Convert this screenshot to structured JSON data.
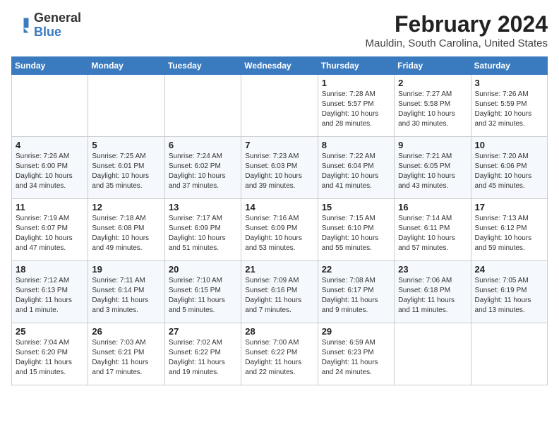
{
  "header": {
    "logo_general": "General",
    "logo_blue": "Blue",
    "month_year": "February 2024",
    "location": "Mauldin, South Carolina, United States"
  },
  "weekdays": [
    "Sunday",
    "Monday",
    "Tuesday",
    "Wednesday",
    "Thursday",
    "Friday",
    "Saturday"
  ],
  "weeks": [
    [
      {
        "day": "",
        "content": ""
      },
      {
        "day": "",
        "content": ""
      },
      {
        "day": "",
        "content": ""
      },
      {
        "day": "",
        "content": ""
      },
      {
        "day": "1",
        "content": "Sunrise: 7:28 AM\nSunset: 5:57 PM\nDaylight: 10 hours\nand 28 minutes."
      },
      {
        "day": "2",
        "content": "Sunrise: 7:27 AM\nSunset: 5:58 PM\nDaylight: 10 hours\nand 30 minutes."
      },
      {
        "day": "3",
        "content": "Sunrise: 7:26 AM\nSunset: 5:59 PM\nDaylight: 10 hours\nand 32 minutes."
      }
    ],
    [
      {
        "day": "4",
        "content": "Sunrise: 7:26 AM\nSunset: 6:00 PM\nDaylight: 10 hours\nand 34 minutes."
      },
      {
        "day": "5",
        "content": "Sunrise: 7:25 AM\nSunset: 6:01 PM\nDaylight: 10 hours\nand 35 minutes."
      },
      {
        "day": "6",
        "content": "Sunrise: 7:24 AM\nSunset: 6:02 PM\nDaylight: 10 hours\nand 37 minutes."
      },
      {
        "day": "7",
        "content": "Sunrise: 7:23 AM\nSunset: 6:03 PM\nDaylight: 10 hours\nand 39 minutes."
      },
      {
        "day": "8",
        "content": "Sunrise: 7:22 AM\nSunset: 6:04 PM\nDaylight: 10 hours\nand 41 minutes."
      },
      {
        "day": "9",
        "content": "Sunrise: 7:21 AM\nSunset: 6:05 PM\nDaylight: 10 hours\nand 43 minutes."
      },
      {
        "day": "10",
        "content": "Sunrise: 7:20 AM\nSunset: 6:06 PM\nDaylight: 10 hours\nand 45 minutes."
      }
    ],
    [
      {
        "day": "11",
        "content": "Sunrise: 7:19 AM\nSunset: 6:07 PM\nDaylight: 10 hours\nand 47 minutes."
      },
      {
        "day": "12",
        "content": "Sunrise: 7:18 AM\nSunset: 6:08 PM\nDaylight: 10 hours\nand 49 minutes."
      },
      {
        "day": "13",
        "content": "Sunrise: 7:17 AM\nSunset: 6:09 PM\nDaylight: 10 hours\nand 51 minutes."
      },
      {
        "day": "14",
        "content": "Sunrise: 7:16 AM\nSunset: 6:09 PM\nDaylight: 10 hours\nand 53 minutes."
      },
      {
        "day": "15",
        "content": "Sunrise: 7:15 AM\nSunset: 6:10 PM\nDaylight: 10 hours\nand 55 minutes."
      },
      {
        "day": "16",
        "content": "Sunrise: 7:14 AM\nSunset: 6:11 PM\nDaylight: 10 hours\nand 57 minutes."
      },
      {
        "day": "17",
        "content": "Sunrise: 7:13 AM\nSunset: 6:12 PM\nDaylight: 10 hours\nand 59 minutes."
      }
    ],
    [
      {
        "day": "18",
        "content": "Sunrise: 7:12 AM\nSunset: 6:13 PM\nDaylight: 11 hours\nand 1 minute."
      },
      {
        "day": "19",
        "content": "Sunrise: 7:11 AM\nSunset: 6:14 PM\nDaylight: 11 hours\nand 3 minutes."
      },
      {
        "day": "20",
        "content": "Sunrise: 7:10 AM\nSunset: 6:15 PM\nDaylight: 11 hours\nand 5 minutes."
      },
      {
        "day": "21",
        "content": "Sunrise: 7:09 AM\nSunset: 6:16 PM\nDaylight: 11 hours\nand 7 minutes."
      },
      {
        "day": "22",
        "content": "Sunrise: 7:08 AM\nSunset: 6:17 PM\nDaylight: 11 hours\nand 9 minutes."
      },
      {
        "day": "23",
        "content": "Sunrise: 7:06 AM\nSunset: 6:18 PM\nDaylight: 11 hours\nand 11 minutes."
      },
      {
        "day": "24",
        "content": "Sunrise: 7:05 AM\nSunset: 6:19 PM\nDaylight: 11 hours\nand 13 minutes."
      }
    ],
    [
      {
        "day": "25",
        "content": "Sunrise: 7:04 AM\nSunset: 6:20 PM\nDaylight: 11 hours\nand 15 minutes."
      },
      {
        "day": "26",
        "content": "Sunrise: 7:03 AM\nSunset: 6:21 PM\nDaylight: 11 hours\nand 17 minutes."
      },
      {
        "day": "27",
        "content": "Sunrise: 7:02 AM\nSunset: 6:22 PM\nDaylight: 11 hours\nand 19 minutes."
      },
      {
        "day": "28",
        "content": "Sunrise: 7:00 AM\nSunset: 6:22 PM\nDaylight: 11 hours\nand 22 minutes."
      },
      {
        "day": "29",
        "content": "Sunrise: 6:59 AM\nSunset: 6:23 PM\nDaylight: 11 hours\nand 24 minutes."
      },
      {
        "day": "",
        "content": ""
      },
      {
        "day": "",
        "content": ""
      }
    ]
  ]
}
